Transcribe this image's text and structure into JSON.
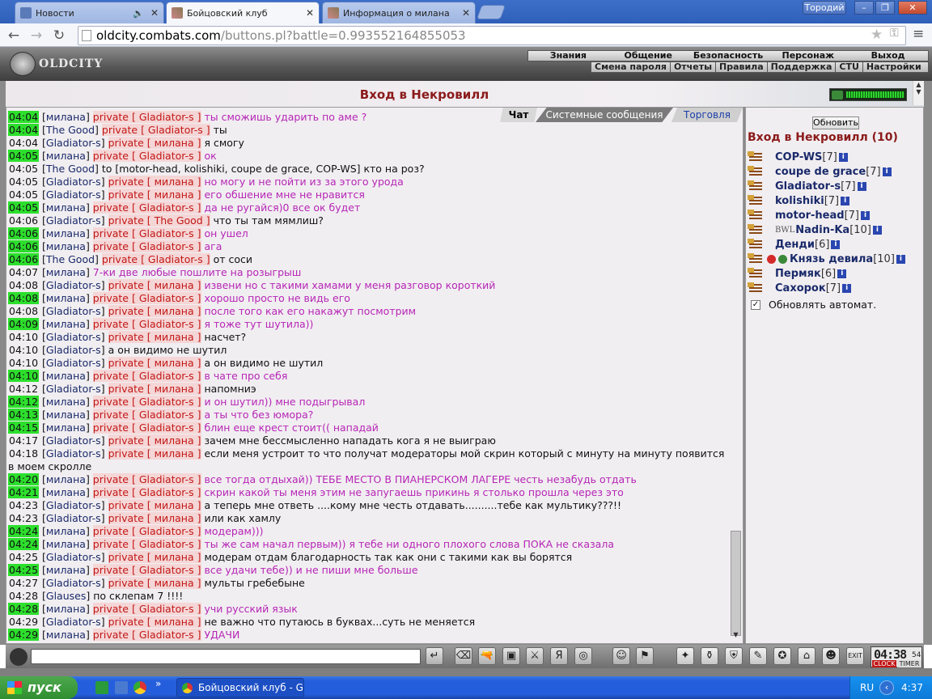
{
  "browser": {
    "tabs": [
      {
        "label": "Новости"
      },
      {
        "label": "Бойцовский клуб"
      },
      {
        "label": "Информация о милана"
      }
    ],
    "user": "Tородий",
    "url_domain": "oldcity.combats.com",
    "url_path": "/buttons.pl?battle=0.993552164855053"
  },
  "game": {
    "logo": "OLDCITY",
    "menu_top": [
      "Знания",
      "Общение",
      "Безопасность",
      "Персонаж",
      "Выход"
    ],
    "menu_sub": [
      "Смена пароля",
      "Отчеты",
      "Правила",
      "Поддержка",
      "CTU",
      "Настройки"
    ],
    "room_title": "Вход в Некровилл",
    "chat_tabs": [
      "Чат",
      "Системные сообщения",
      "Торговля"
    ],
    "chat": [
      {
        "t": "04:04",
        "hl": true,
        "n": "милана",
        "p": "Gladiator-s",
        "m": "ты сможишь ударить по аме ?",
        "pk": true
      },
      {
        "t": "04:04",
        "hl": true,
        "n": "The Good",
        "p": "Gladiator-s",
        "m": "ты",
        "pk": false
      },
      {
        "t": "04:04",
        "hl": false,
        "n": "Gladiator-s",
        "p": "милана",
        "m": "я смогу",
        "pk": false
      },
      {
        "t": "04:05",
        "hl": true,
        "n": "милана",
        "p": "Gladiator-s",
        "m": "ок",
        "pk": true
      },
      {
        "t": "04:05",
        "hl": false,
        "n": "The Good",
        "p": "",
        "m": "to [motor-head, kolishiki, coupe de grace, COP-WS] кто на роз?",
        "pk": false
      },
      {
        "t": "04:05",
        "hl": false,
        "n": "Gladiator-s",
        "p": "милана",
        "m": "но могу и не пойти из за этого урода",
        "pk": true
      },
      {
        "t": "04:05",
        "hl": false,
        "n": "Gladiator-s",
        "p": "милана",
        "m": "его обшение мне не нравится",
        "pk": true
      },
      {
        "t": "04:05",
        "hl": true,
        "n": "милана",
        "p": "Gladiator-s",
        "m": "да не ругайся)0 все ок будет",
        "pk": true
      },
      {
        "t": "04:06",
        "hl": false,
        "n": "Gladiator-s",
        "p": "The Good",
        "m": "что ты там мямлиш?",
        "pk": false
      },
      {
        "t": "04:06",
        "hl": true,
        "n": "милана",
        "p": "Gladiator-s",
        "m": "он ушел",
        "pk": true
      },
      {
        "t": "04:06",
        "hl": true,
        "n": "милана",
        "p": "Gladiator-s",
        "m": "ага",
        "pk": true
      },
      {
        "t": "04:06",
        "hl": true,
        "n": "The Good",
        "p": "Gladiator-s",
        "m": "от соси",
        "pk": false
      },
      {
        "t": "04:07",
        "hl": false,
        "n": "милана",
        "p": "",
        "m": "7-ки две любые пошлите на розыгрыш",
        "pk": true
      },
      {
        "t": "04:08",
        "hl": false,
        "n": "Gladiator-s",
        "p": "милана",
        "m": "извени но с такими хамами у меня разговор короткий",
        "pk": true
      },
      {
        "t": "04:08",
        "hl": true,
        "n": "милана",
        "p": "Gladiator-s",
        "m": "хорошо просто не видь его",
        "pk": true
      },
      {
        "t": "04:08",
        "hl": false,
        "n": "Gladiator-s",
        "p": "милана",
        "m": "после того как его накажут посмотрим",
        "pk": true
      },
      {
        "t": "04:09",
        "hl": true,
        "n": "милана",
        "p": "Gladiator-s",
        "m": "я тоже тут шутила))",
        "pk": true
      },
      {
        "t": "04:10",
        "hl": false,
        "n": "Gladiator-s",
        "p": "милана",
        "m": "насчет?",
        "pk": false
      },
      {
        "t": "04:10",
        "hl": false,
        "n": "Gladiator-s",
        "p": "",
        "m": "а он видимо не шутил",
        "pk": false
      },
      {
        "t": "04:10",
        "hl": false,
        "n": "Gladiator-s",
        "p": "милана",
        "m": "а он видимо не шутил",
        "pk": false
      },
      {
        "t": "04:10",
        "hl": true,
        "n": "милана",
        "p": "Gladiator-s",
        "m": "в чате про себя",
        "pk": true
      },
      {
        "t": "04:12",
        "hl": false,
        "n": "Gladiator-s",
        "p": "милана",
        "m": "напомниэ",
        "pk": false
      },
      {
        "t": "04:12",
        "hl": true,
        "n": "милана",
        "p": "Gladiator-s",
        "m": "и он шутил)) мне подыгрывал",
        "pk": true
      },
      {
        "t": "04:13",
        "hl": true,
        "n": "милана",
        "p": "Gladiator-s",
        "m": "а ты что без юмора?",
        "pk": true
      },
      {
        "t": "04:15",
        "hl": true,
        "n": "милана",
        "p": "Gladiator-s",
        "m": "блин еще крест стоит(( нападай",
        "pk": true
      },
      {
        "t": "04:17",
        "hl": false,
        "n": "Gladiator-s",
        "p": "милана",
        "m": "зачем мне бессмысленно нападать кога я не выиграю",
        "pk": false
      },
      {
        "t": "04:18",
        "hl": false,
        "n": "Gladiator-s",
        "p": "милана",
        "m": "если меня устроит то что получат модераторы мой скрин который с минуту на минуту появится в моем скролле",
        "pk": false,
        "wrap": true
      },
      {
        "t": "04:20",
        "hl": true,
        "n": "милана",
        "p": "Gladiator-s",
        "m": "все тогда отдыхай)) ТЕБЕ МЕСТО В ПИАНЕРСКОМ ЛАГЕРЕ честь незабудь отдать",
        "pk": true
      },
      {
        "t": "04:21",
        "hl": true,
        "n": "милана",
        "p": "Gladiator-s",
        "m": "скрин какой ты меня этим не запугаешь прикинь я столько прошла через это",
        "pk": true
      },
      {
        "t": "04:23",
        "hl": false,
        "n": "Gladiator-s",
        "p": "милана",
        "m": "а теперь мне ответь ....кому мне честь отдавать..........тебе как мультику???!!",
        "pk": false
      },
      {
        "t": "04:23",
        "hl": false,
        "n": "Gladiator-s",
        "p": "милана",
        "m": "или как хамлу",
        "pk": false
      },
      {
        "t": "04:24",
        "hl": true,
        "n": "милана",
        "p": "Gladiator-s",
        "m": "модерам)))",
        "pk": true
      },
      {
        "t": "04:24",
        "hl": true,
        "n": "милана",
        "p": "Gladiator-s",
        "m": "ты же сам начал первым)) я тебе ни одного плохого слова ПОКА не сказала",
        "pk": true
      },
      {
        "t": "04:25",
        "hl": false,
        "n": "Gladiator-s",
        "p": "милана",
        "m": "модерам отдам благодарность так как они с такими как вы борятся",
        "pk": false
      },
      {
        "t": "04:25",
        "hl": true,
        "n": "милана",
        "p": "Gladiator-s",
        "m": "все удачи тебе)) и не пиши мне больше",
        "pk": true
      },
      {
        "t": "04:27",
        "hl": false,
        "n": "Gladiator-s",
        "p": "милана",
        "m": "мульты гребебыне",
        "pk": false
      },
      {
        "t": "04:28",
        "hl": false,
        "n": "Glauses",
        "p": "",
        "m": "по склепам 7 !!!!",
        "pk": false
      },
      {
        "t": "04:28",
        "hl": true,
        "n": "милана",
        "p": "Gladiator-s",
        "m": "учи русский язык",
        "pk": true
      },
      {
        "t": "04:29",
        "hl": false,
        "n": "Gladiator-s",
        "p": "милана",
        "m": "не важно что путаюсь в буквах...суть не меняется",
        "pk": false
      },
      {
        "t": "04:29",
        "hl": true,
        "n": "милана",
        "p": "Gladiator-s",
        "m": "УДАЧИ",
        "pk": true
      }
    ],
    "private_word": "private",
    "refresh_label": "Обновить",
    "room_list_title": "Вход в Некровилл (10)",
    "users": [
      {
        "name": "COP-WS",
        "level": "[7]",
        "clan": "",
        "badge": ""
      },
      {
        "name": "coupe de grace",
        "level": "[7]",
        "clan": "",
        "badge": ""
      },
      {
        "name": "Gladiator-s",
        "level": "[7]",
        "clan": "",
        "badge": ""
      },
      {
        "name": "kolishiki",
        "level": "[7]",
        "clan": "",
        "badge": ""
      },
      {
        "name": "motor-head",
        "level": "[7]",
        "clan": "",
        "badge": ""
      },
      {
        "name": "Nadin-Ka",
        "level": "[10]",
        "clan": "BWL",
        "badge": ""
      },
      {
        "name": "Денди",
        "level": "[6]",
        "clan": "",
        "badge": ""
      },
      {
        "name": "Князь девила",
        "level": "[10]",
        "clan": "",
        "badge": "#d42a2a"
      },
      {
        "name": "Пермяк",
        "level": "[6]",
        "clan": "",
        "badge": ""
      },
      {
        "name": "Сахорок",
        "level": "[7]",
        "clan": "",
        "badge": ""
      }
    ],
    "auto_update_label": "Обновлять автомат.",
    "clock": {
      "time": "04:38",
      "sec": "54",
      "clock_label": "CLOCK",
      "timer_label": "TIMER"
    }
  },
  "taskbar": {
    "start_label": "пуск",
    "window_label": "Бойцовский клуб - G...",
    "lang": "RU",
    "time": "4:37"
  }
}
